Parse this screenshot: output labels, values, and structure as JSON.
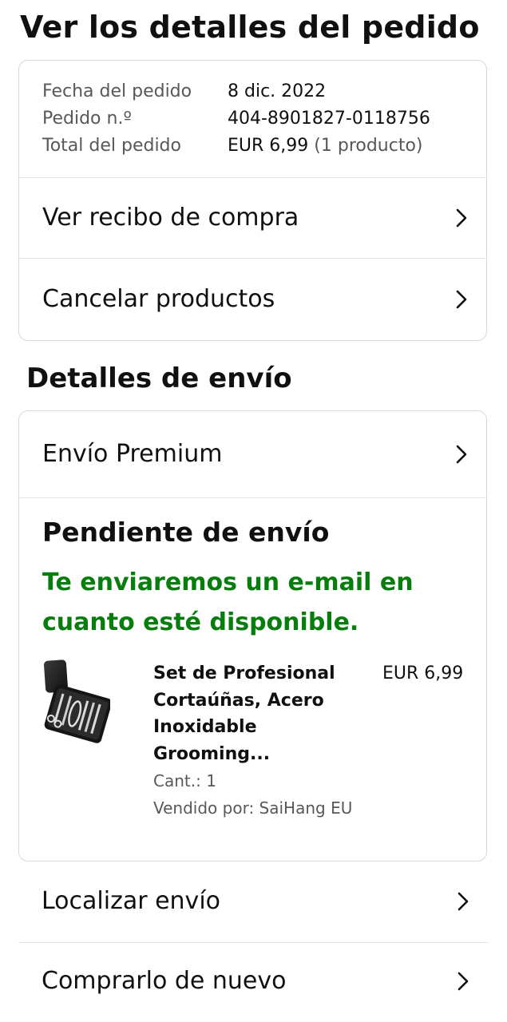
{
  "header": {
    "title": "Ver los detalles del pedido"
  },
  "order_info": {
    "date_label": "Fecha del pedido",
    "date_value": "8 dic. 2022",
    "number_label": "Pedido n.º",
    "number_value": "404-8901827-0118756",
    "total_label": "Total del pedido",
    "total_value": "EUR 6,99",
    "total_count": "(1 producto)"
  },
  "order_actions": {
    "receipt_label": "Ver recibo de compra",
    "cancel_label": "Cancelar productos"
  },
  "shipping": {
    "section_title": "Detalles de envío",
    "method_label": "Envío Premium",
    "status_title": "Pendiente de envío",
    "status_message": "Te enviaremos un e-mail en cuanto esté disponible.",
    "status_color": "#067d0d"
  },
  "product": {
    "name": "Set de Profesional Cortaúñas, Acero Inoxidable Grooming...",
    "price": "EUR 6,99",
    "quantity": "Cant.: 1",
    "seller": "Vendido por: SaiHang EU",
    "image_icon": "nail-clipper-set-image"
  },
  "bottom_actions": {
    "track_label": "Localizar envío",
    "buy_again_label": "Comprarlo de nuevo"
  },
  "icons": {
    "chevron": "chevron-right-icon"
  }
}
